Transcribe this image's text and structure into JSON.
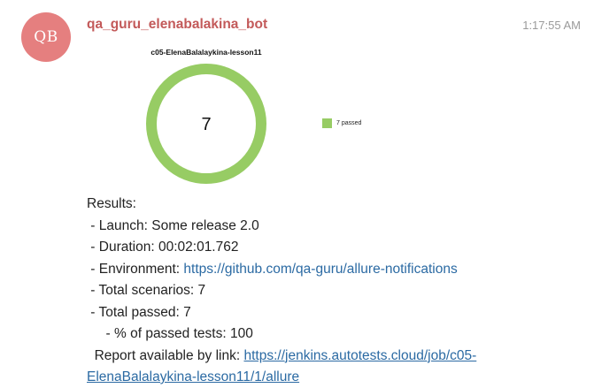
{
  "sender": {
    "initials": "QB",
    "name": "qa_guru_elenabalakina_bot",
    "avatar_color": "#e57f7f"
  },
  "timestamp": "1:17:55 AM",
  "chart_data": {
    "type": "pie",
    "title": "c05-ElenaBalalaykina-lesson11",
    "center_label": "7",
    "series": [
      {
        "name": "7 passed",
        "value": 7,
        "color": "#97cc64"
      }
    ],
    "legend_position": "right"
  },
  "results": {
    "heading": "Results:",
    "launch": " - Launch: Some release 2.0",
    "duration": " - Duration: 00:02:01.762",
    "environment_label": " - Environment: ",
    "environment_link": "https://github.com/qa-guru/allure-notifications",
    "total_scenarios": " - Total scenarios: 7",
    "total_passed": " - Total passed: 7",
    "percent_passed": "     - % of passed tests: 100",
    "report_label": "  Report available by link: ",
    "report_link_part1": "https://jenkins.autotests.cloud/job/c05-",
    "report_link_part2": "ElenaBalalaykina-lesson11/1/allure"
  }
}
